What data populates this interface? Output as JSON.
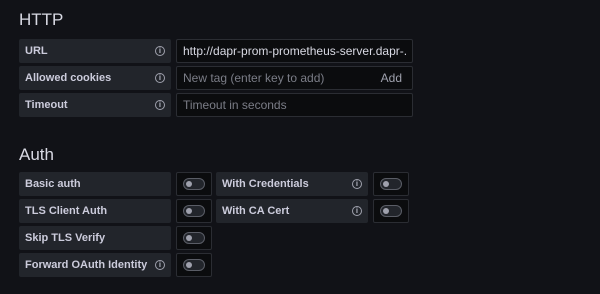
{
  "http": {
    "title": "HTTP",
    "url": {
      "label": "URL",
      "value": "http://dapr-prom-prometheus-server.dapr-..."
    },
    "allowed_cookies": {
      "label": "Allowed cookies",
      "placeholder": "New tag (enter key to add)",
      "add_label": "Add"
    },
    "timeout": {
      "label": "Timeout",
      "placeholder": "Timeout in seconds"
    }
  },
  "auth": {
    "title": "Auth",
    "basic_auth": {
      "label": "Basic auth",
      "enabled": false
    },
    "with_credentials": {
      "label": "With Credentials",
      "enabled": false
    },
    "tls_client_auth": {
      "label": "TLS Client Auth",
      "enabled": false
    },
    "with_ca_cert": {
      "label": "With CA Cert",
      "enabled": false
    },
    "skip_tls_verify": {
      "label": "Skip TLS Verify",
      "enabled": false
    },
    "forward_oauth": {
      "label": "Forward OAuth Identity",
      "enabled": false
    }
  },
  "icons": {
    "info": "info-icon"
  },
  "colors": {
    "background": "#111217",
    "label_bg": "#22252b",
    "input_bg": "#0b0c0e"
  }
}
